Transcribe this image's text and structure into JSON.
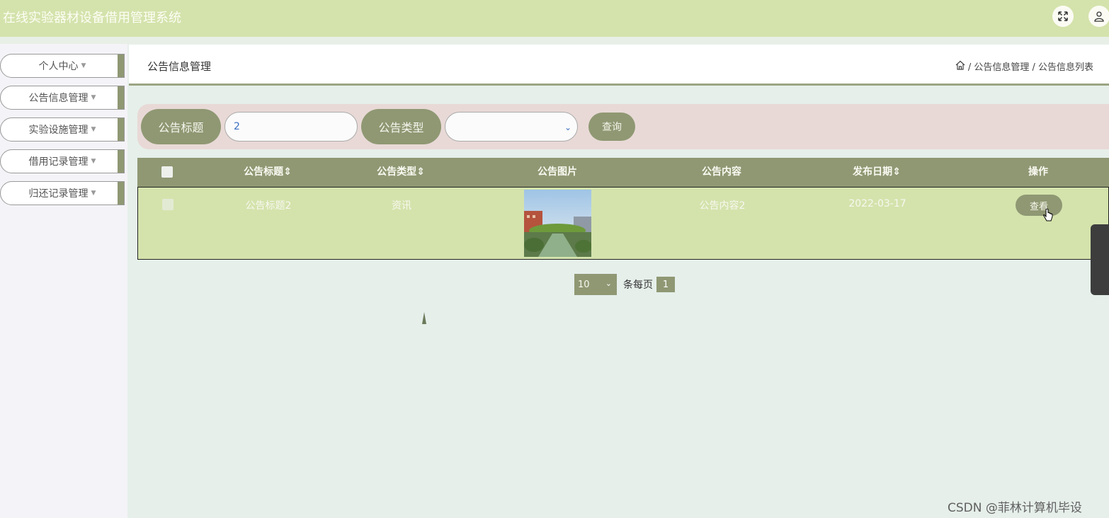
{
  "header": {
    "title": "在线实验器材设备借用管理系统"
  },
  "sidebar": {
    "items": [
      {
        "label": "个人中心"
      },
      {
        "label": "公告信息管理"
      },
      {
        "label": "实验设施管理"
      },
      {
        "label": "借用记录管理"
      },
      {
        "label": "归还记录管理"
      }
    ]
  },
  "breadcrumb": {
    "page_title": "公告信息管理",
    "trail": "/ 公告信息管理 / 公告信息列表"
  },
  "search": {
    "title_label": "公告标题",
    "title_value": "2",
    "type_label": "公告类型",
    "type_value": "",
    "query_button": "查询"
  },
  "table": {
    "headers": [
      "公告标题",
      "公告类型",
      "公告图片",
      "公告内容",
      "发布日期",
      "操作"
    ],
    "rows": [
      {
        "title": "公告标题2",
        "type": "资讯",
        "content": "公告内容2",
        "date": "2022-03-17",
        "action": "查看"
      }
    ]
  },
  "pagination": {
    "page_size": "10",
    "per_page_label": "条每页",
    "current_page": "1"
  },
  "watermark": "CSDN @菲林计算机毕设",
  "colors": {
    "header_bg": "#d4e3ac",
    "accent": "#8f9873",
    "page_bg": "#e6efea",
    "search_bg": "#e8d9d6"
  }
}
